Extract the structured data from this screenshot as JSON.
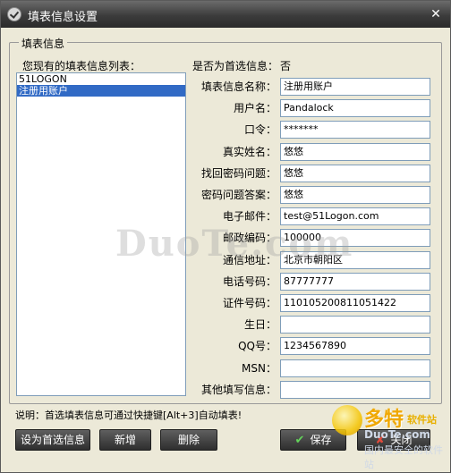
{
  "window": {
    "title": "填表信息设置",
    "close_glyph": "✕",
    "accent_color": "#316ac5"
  },
  "group": {
    "legend": "填表信息"
  },
  "list": {
    "label": "您现有的填表信息列表：",
    "items": [
      {
        "label": "51LOGON",
        "selected": false
      },
      {
        "label": "注册用账户",
        "selected": true
      }
    ]
  },
  "default_info": {
    "label": "是否为首选信息：",
    "value": "否"
  },
  "fields": [
    {
      "label": "填表信息名称：",
      "value": "注册用账户"
    },
    {
      "label": "用户名：",
      "value": "Pandalock"
    },
    {
      "label": "口令：",
      "value": "*******"
    },
    {
      "label": "真实姓名：",
      "value": "悠悠"
    },
    {
      "label": "找回密码问题：",
      "value": "悠悠"
    },
    {
      "label": "密码问题答案：",
      "value": "悠悠"
    },
    {
      "label": "电子邮件：",
      "value": "test@51Logon.com"
    },
    {
      "label": "邮政编码：",
      "value": "100000"
    },
    {
      "label": "通信地址：",
      "value": "北京市朝阳区"
    },
    {
      "label": "电话号码：",
      "value": "87777777"
    },
    {
      "label": "证件号码：",
      "value": "110105200811051422"
    },
    {
      "label": "生日：",
      "value": ""
    },
    {
      "label": "QQ号：",
      "value": "1234567890"
    },
    {
      "label": "MSN：",
      "value": ""
    },
    {
      "label": "其他填写信息：",
      "value": ""
    }
  ],
  "hint": "说明：首选填表信息可通过快捷键[Alt+3]自动填表!",
  "buttons": {
    "set_default": "设为首选信息",
    "add": "新增",
    "delete": "删除",
    "save": "保存",
    "close": "关闭",
    "save_icon": "check-icon",
    "close_icon": "cross-icon"
  },
  "watermark": "DuoTe.com",
  "brand": {
    "name": "多特",
    "sub": "软件站",
    "url": "DuoTe.com",
    "slogan": "国内最安全的软件站"
  }
}
